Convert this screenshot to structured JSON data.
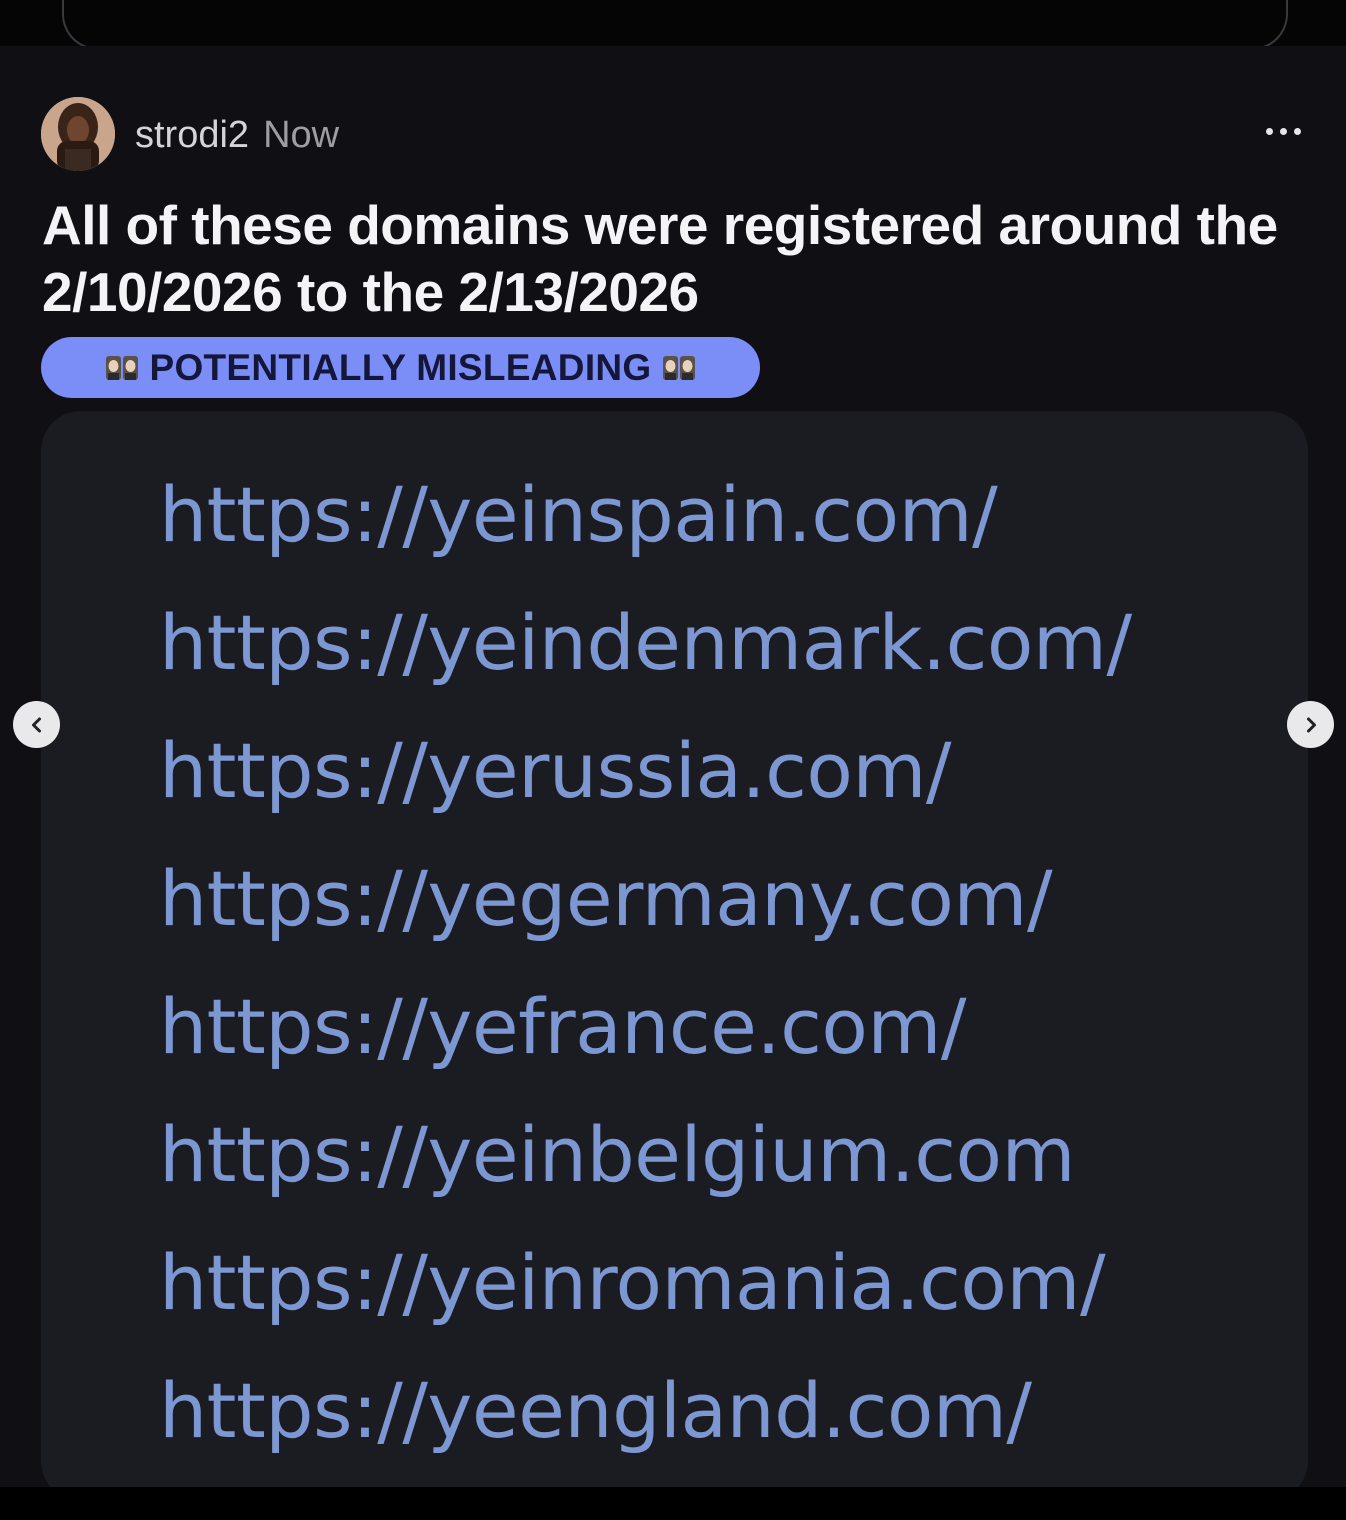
{
  "post": {
    "username": "strodi2",
    "time": "Now",
    "title": "All of these domains were registered around the 2/10/2026 to the 2/13/2026",
    "flair": {
      "label": "POTENTIALLY MISLEADING",
      "color": "#7b8ef7",
      "emoji": "two-faces-emoji"
    },
    "more_icon": "more-horizontal-icon"
  },
  "media": {
    "urls": [
      "https://yeinspain.com/",
      "https://yeindenmark.com/",
      "https://yerussia.com/",
      "https://yegermany.com/",
      "https://yefrance.com/",
      "https://yeinbelgium.com",
      "https://yeinromania.com/",
      "https://yeengland.com/"
    ],
    "link_color": "#7c97d2",
    "prev_icon": "chevron-left-icon",
    "next_icon": "chevron-right-icon"
  }
}
